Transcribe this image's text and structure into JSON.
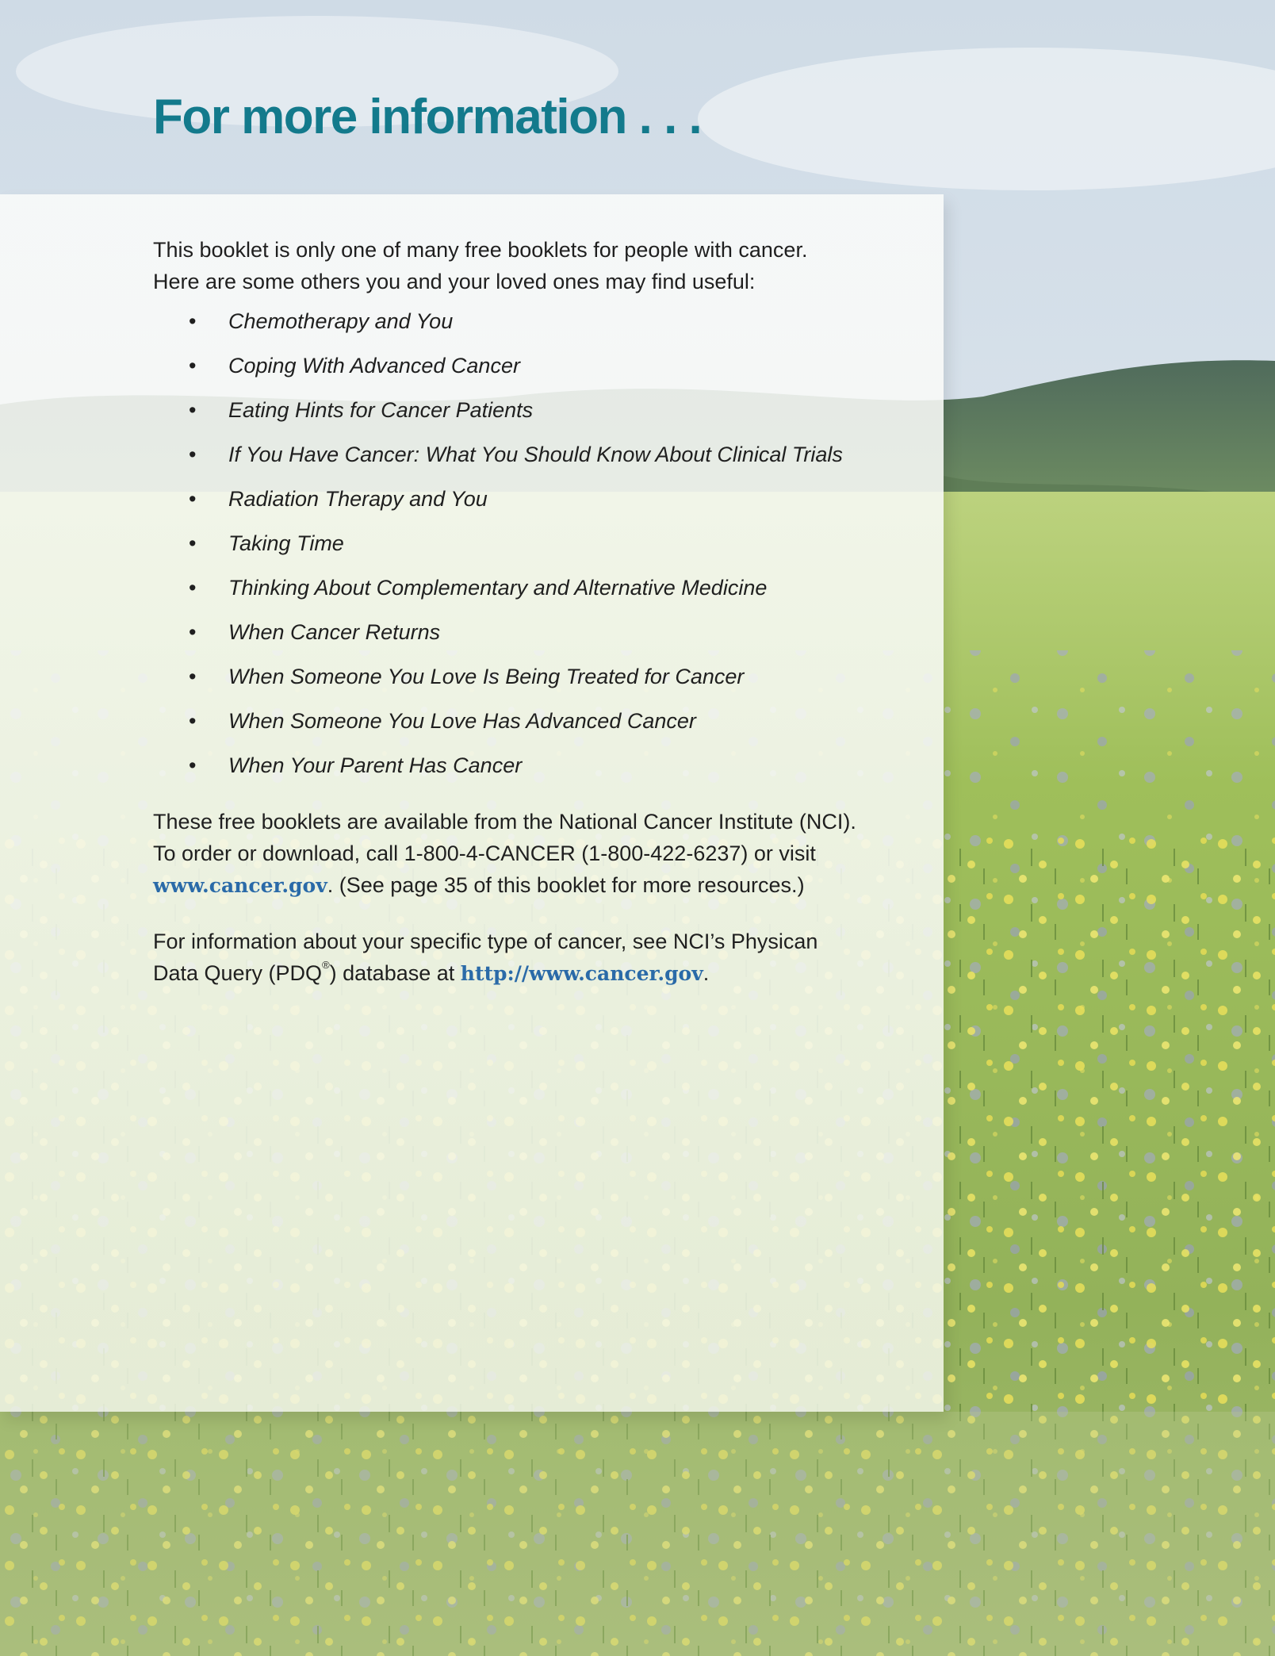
{
  "page": {
    "title": "For more information . . ."
  },
  "intro": {
    "line1": "This booklet is only one of many free booklets for people with cancer.",
    "line2": "Here are some others you and your loved ones may find useful:"
  },
  "booklets": [
    "Chemotherapy and You",
    "Coping With Advanced Cancer",
    "Eating Hints for Cancer Patients",
    "If You Have Cancer: What You Should Know About Clinical Trials",
    "Radiation Therapy and You",
    "Taking Time",
    "Thinking About Complementary and Alternative Medicine",
    "When Cancer Returns",
    "When Someone You Love Is Being Treated for Cancer",
    "When Someone You Love Has Advanced Cancer",
    "When Your Parent Has Cancer"
  ],
  "bullet_char": "•",
  "availability": {
    "text_before_link": "These free booklets are available from the National Cancer Institute (NCI). To order or download, call 1-800-4-CANCER (1-800-422-6237) or visit ",
    "link_text": "www.cancer.gov",
    "text_after_link": ". (See page 35 of this booklet for more resources.)"
  },
  "pdq": {
    "text_before": "For information about your specific type of cancer, see NCI’s Physican Data Query (PDQ",
    "registered_mark": "®",
    "text_mid": ") database at ",
    "link_text": "http://www.cancer.gov",
    "text_after": "."
  },
  "colors": {
    "title": "#137a8c",
    "link": "#2a6aa8",
    "body_text": "#1f1f1f"
  }
}
